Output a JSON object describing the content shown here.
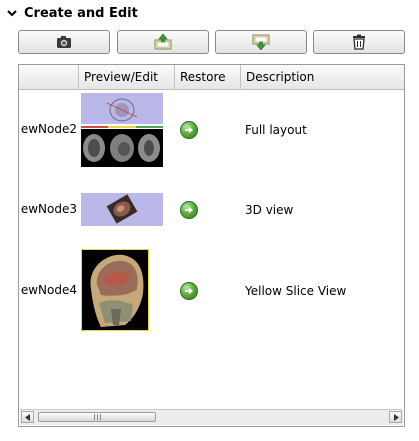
{
  "section": {
    "title": "Create and Edit"
  },
  "toolbar": {
    "buttons": [
      {
        "icon": "camera-icon"
      },
      {
        "icon": "restore-scene-icon"
      },
      {
        "icon": "save-scene-icon"
      },
      {
        "icon": "trash-icon"
      }
    ]
  },
  "table": {
    "columns": [
      "",
      "Preview/Edit",
      "Restore",
      "Description"
    ],
    "rows": [
      {
        "name": "ewNode2",
        "description": "Full layout",
        "thumbnail": "full-layout-thumbnail",
        "restore_icon": "restore-arrow-icon"
      },
      {
        "name": "ewNode3",
        "description": "3D view",
        "thumbnail": "3d-view-thumbnail",
        "restore_icon": "restore-arrow-icon"
      },
      {
        "name": "ewNode4",
        "description": "Yellow Slice View",
        "thumbnail": "yellow-slice-thumbnail",
        "restore_icon": "restore-arrow-icon"
      }
    ]
  },
  "colors": {
    "restore_green": "#4c9a32",
    "slice_yellow": "#e8d64a",
    "thumb_lavender": "#b9b8e8"
  }
}
